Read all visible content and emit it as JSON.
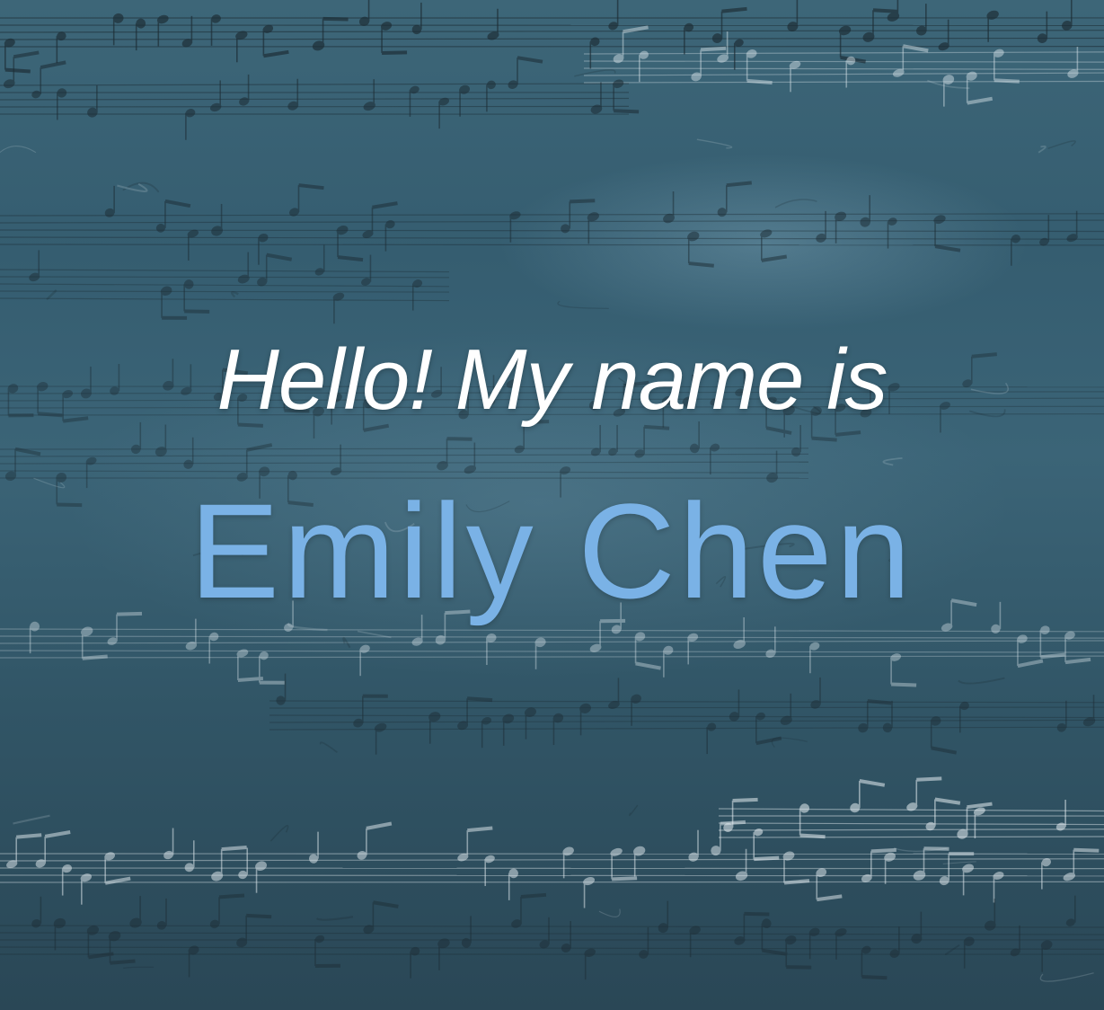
{
  "greeting": {
    "text": "Hello! My name is"
  },
  "person": {
    "name": "Emily Chen"
  },
  "colors": {
    "background": "#355d70",
    "greeting": "#ffffff",
    "name": "#7ab2e6"
  },
  "background_motif": "handwritten-sheet-music"
}
